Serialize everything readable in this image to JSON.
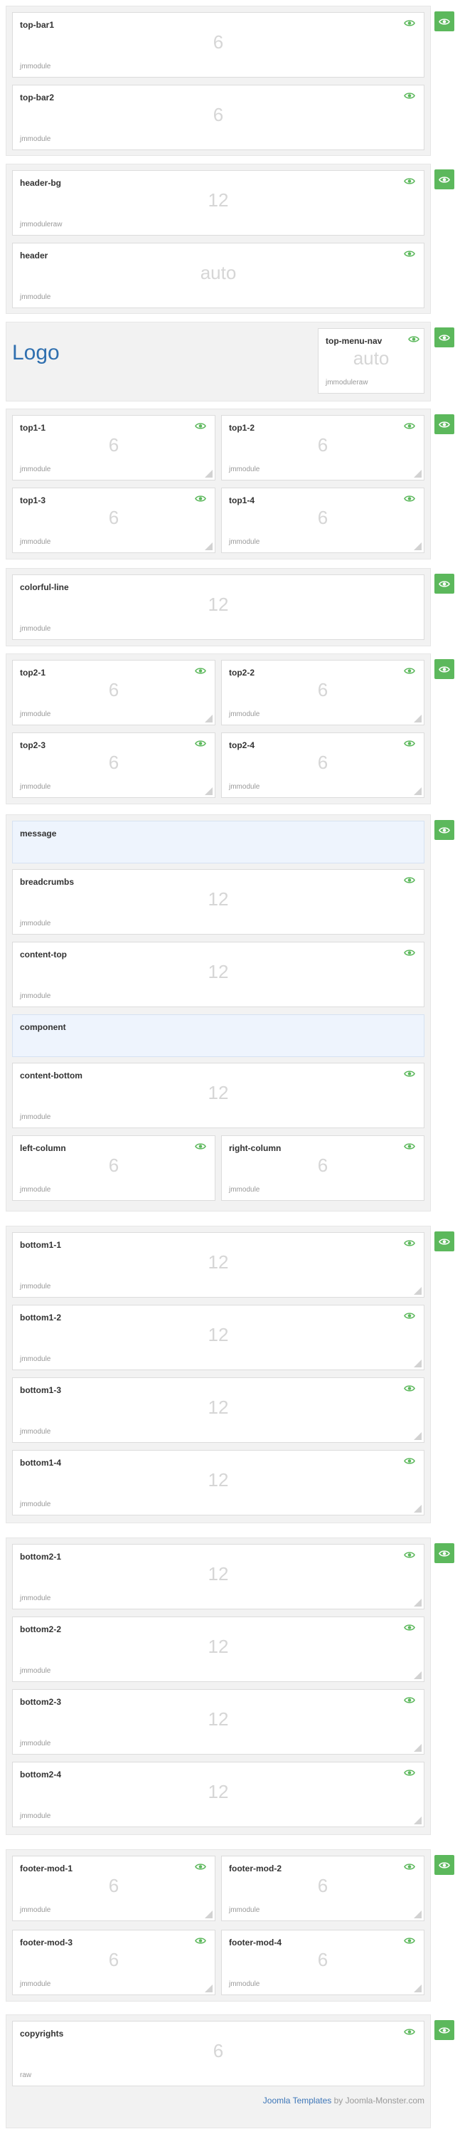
{
  "colors": {
    "accent": "#5cb85c",
    "logo": "#2f6faf",
    "link": "#3d76b8",
    "system_bg": "#eef4fd"
  },
  "icons": {
    "visibility": "eye-icon",
    "resize": "resize-handle-icon"
  },
  "sections": {
    "topbar": {
      "positions": [
        {
          "name": "top-bar1",
          "size": "6",
          "type": "jmmodule"
        },
        {
          "name": "top-bar2",
          "size": "6",
          "type": "jmmodule"
        }
      ]
    },
    "header": {
      "positions": [
        {
          "name": "header-bg",
          "size": "12",
          "type": "jmmoduleraw"
        },
        {
          "name": "header",
          "size": "auto",
          "type": "jmmodule"
        }
      ]
    },
    "logo_row": {
      "logo": "Logo",
      "nav": {
        "name": "top-menu-nav",
        "size": "auto",
        "type": "jmmoduleraw"
      }
    },
    "top1": {
      "positions": [
        {
          "name": "top1-1",
          "size": "6",
          "type": "jmmodule"
        },
        {
          "name": "top1-2",
          "size": "6",
          "type": "jmmodule"
        },
        {
          "name": "top1-3",
          "size": "6",
          "type": "jmmodule"
        },
        {
          "name": "top1-4",
          "size": "6",
          "type": "jmmodule"
        }
      ]
    },
    "colorful": {
      "positions": [
        {
          "name": "colorful-line",
          "size": "12",
          "type": "jmmodule"
        }
      ]
    },
    "top2": {
      "positions": [
        {
          "name": "top2-1",
          "size": "6",
          "type": "jmmodule"
        },
        {
          "name": "top2-2",
          "size": "6",
          "type": "jmmodule"
        },
        {
          "name": "top2-3",
          "size": "6",
          "type": "jmmodule"
        },
        {
          "name": "top2-4",
          "size": "6",
          "type": "jmmodule"
        }
      ]
    },
    "main": {
      "message": "message",
      "breadcrumbs": {
        "name": "breadcrumbs",
        "size": "12",
        "type": "jmmodule"
      },
      "content_top": {
        "name": "content-top",
        "size": "12",
        "type": "jmmodule"
      },
      "component": "component",
      "content_bottom": {
        "name": "content-bottom",
        "size": "12",
        "type": "jmmodule"
      },
      "left_column": {
        "name": "left-column",
        "size": "6",
        "type": "jmmodule"
      },
      "right_column": {
        "name": "right-column",
        "size": "6",
        "type": "jmmodule"
      }
    },
    "bottom1": {
      "positions": [
        {
          "name": "bottom1-1",
          "size": "12",
          "type": "jmmodule"
        },
        {
          "name": "bottom1-2",
          "size": "12",
          "type": "jmmodule"
        },
        {
          "name": "bottom1-3",
          "size": "12",
          "type": "jmmodule"
        },
        {
          "name": "bottom1-4",
          "size": "12",
          "type": "jmmodule"
        }
      ]
    },
    "bottom2": {
      "positions": [
        {
          "name": "bottom2-1",
          "size": "12",
          "type": "jmmodule"
        },
        {
          "name": "bottom2-2",
          "size": "12",
          "type": "jmmodule"
        },
        {
          "name": "bottom2-3",
          "size": "12",
          "type": "jmmodule"
        },
        {
          "name": "bottom2-4",
          "size": "12",
          "type": "jmmodule"
        }
      ]
    },
    "footer_mods": {
      "positions": [
        {
          "name": "footer-mod-1",
          "size": "6",
          "type": "jmmodule"
        },
        {
          "name": "footer-mod-2",
          "size": "6",
          "type": "jmmodule"
        },
        {
          "name": "footer-mod-3",
          "size": "6",
          "type": "jmmodule"
        },
        {
          "name": "footer-mod-4",
          "size": "6",
          "type": "jmmodule"
        }
      ]
    },
    "copyrights": {
      "positions": [
        {
          "name": "copyrights",
          "size": "6",
          "type": "raw"
        }
      ]
    }
  },
  "footer": {
    "link_text": "Joomla Templates",
    "suffix": " by Joomla-Monster.com"
  }
}
